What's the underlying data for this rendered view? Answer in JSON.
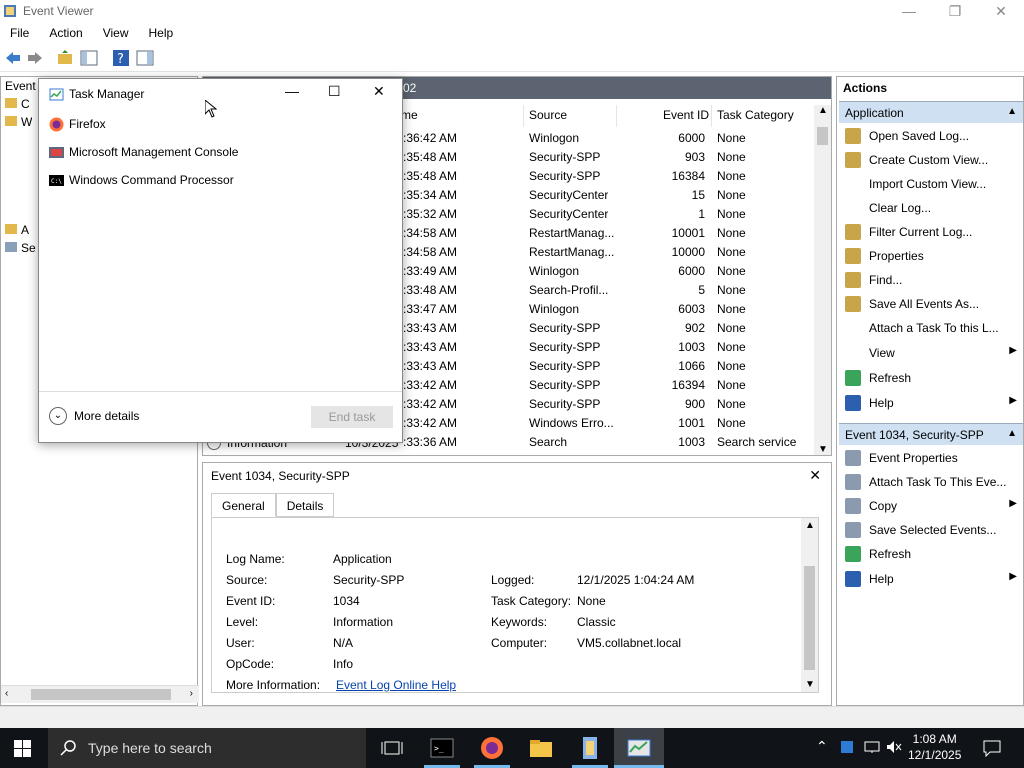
{
  "window": {
    "title": "Event Viewer"
  },
  "menubar": [
    "File",
    "Action",
    "View",
    "Help"
  ],
  "tree": {
    "items": [
      "Event",
      "C",
      "W",
      "A",
      "Se"
    ]
  },
  "list": {
    "header_fragment": "02",
    "columns": [
      "me",
      "Source",
      "Event ID",
      "Task Category"
    ],
    "rows": [
      {
        "time": ":36:42 AM",
        "source": "Winlogon",
        "id": "6000",
        "cat": "None"
      },
      {
        "time": ":35:48 AM",
        "source": "Security-SPP",
        "id": "903",
        "cat": "None"
      },
      {
        "time": ":35:48 AM",
        "source": "Security-SPP",
        "id": "16384",
        "cat": "None"
      },
      {
        "time": ":35:34 AM",
        "source": "SecurityCenter",
        "id": "15",
        "cat": "None"
      },
      {
        "time": ":35:32 AM",
        "source": "SecurityCenter",
        "id": "1",
        "cat": "None"
      },
      {
        "time": ":34:58 AM",
        "source": "RestartManag...",
        "id": "10001",
        "cat": "None"
      },
      {
        "time": ":34:58 AM",
        "source": "RestartManag...",
        "id": "10000",
        "cat": "None"
      },
      {
        "time": ":33:49 AM",
        "source": "Winlogon",
        "id": "6000",
        "cat": "None"
      },
      {
        "time": ":33:48 AM",
        "source": "Search-Profil...",
        "id": "5",
        "cat": "None"
      },
      {
        "time": ":33:47 AM",
        "source": "Winlogon",
        "id": "6003",
        "cat": "None"
      },
      {
        "time": ":33:43 AM",
        "source": "Security-SPP",
        "id": "902",
        "cat": "None"
      },
      {
        "time": ":33:43 AM",
        "source": "Security-SPP",
        "id": "1003",
        "cat": "None"
      },
      {
        "time": ":33:43 AM",
        "source": "Security-SPP",
        "id": "1066",
        "cat": "None"
      },
      {
        "time": ":33:42 AM",
        "source": "Security-SPP",
        "id": "16394",
        "cat": "None"
      },
      {
        "time": ":33:42 AM",
        "source": "Security-SPP",
        "id": "900",
        "cat": "None"
      },
      {
        "time": ":33:42 AM",
        "source": "Windows Erro...",
        "id": "1001",
        "cat": "None"
      },
      {
        "time": ":33:36 AM",
        "source": "Search",
        "id": "1003",
        "cat": "Search service"
      }
    ],
    "partial_row": {
      "level": "Information",
      "date": "10/3/2025"
    }
  },
  "detail": {
    "title": "Event 1034, Security-SPP",
    "tabs": [
      "General",
      "Details"
    ],
    "fields": {
      "log_name_label": "Log Name:",
      "log_name": "Application",
      "source_label": "Source:",
      "source": "Security-SPP",
      "logged_label": "Logged:",
      "logged": "12/1/2025 1:04:24 AM",
      "event_id_label": "Event ID:",
      "event_id": "1034",
      "task_cat_label": "Task Category:",
      "task_cat": "None",
      "level_label": "Level:",
      "level": "Information",
      "keywords_label": "Keywords:",
      "keywords": "Classic",
      "user_label": "User:",
      "user": "N/A",
      "computer_label": "Computer:",
      "computer": "VM5.collabnet.local",
      "opcode_label": "OpCode:",
      "opcode": "Info",
      "more_info_label": "More Information:",
      "more_info_link": "Event Log Online Help"
    }
  },
  "actions": {
    "title": "Actions",
    "section1": "Application",
    "items1": [
      "Open Saved Log...",
      "Create Custom View...",
      "Import Custom View...",
      "Clear Log...",
      "Filter Current Log...",
      "Properties",
      "Find...",
      "Save All Events As...",
      "Attach a Task To this L...",
      "View",
      "Refresh",
      "Help"
    ],
    "section2": "Event 1034, Security-SPP",
    "items2": [
      "Event Properties",
      "Attach Task To This Eve...",
      "Copy",
      "Save Selected Events...",
      "Refresh",
      "Help"
    ]
  },
  "taskmgr": {
    "title": "Task Manager",
    "apps": [
      "Firefox",
      "Microsoft Management Console",
      "Windows Command Processor"
    ],
    "more_details": "More details",
    "end_task": "End task"
  },
  "taskbar": {
    "search_placeholder": "Type here to search",
    "time": "1:08 AM",
    "date": "12/1/2025"
  }
}
